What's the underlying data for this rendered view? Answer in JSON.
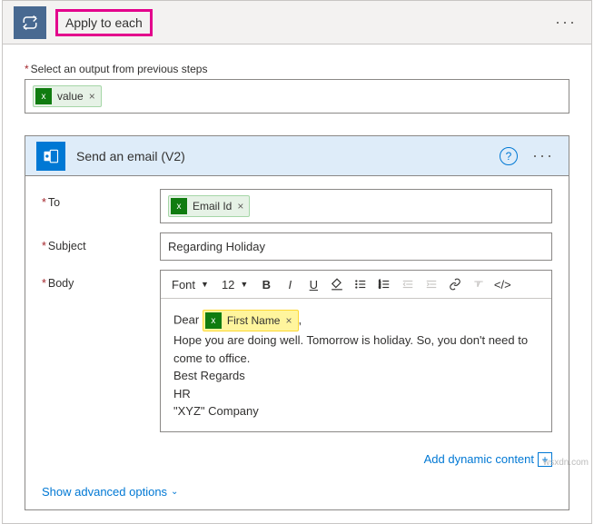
{
  "outer": {
    "title": "Apply to each",
    "output_label": "Select an output from previous steps",
    "value_token": "value"
  },
  "email": {
    "title": "Send an email (V2)",
    "to_label": "To",
    "to_token": "Email Id",
    "subject_label": "Subject",
    "subject_value": "Regarding Holiday",
    "body_label": "Body",
    "font_label": "Font",
    "size_label": "12",
    "greeting": "Dear",
    "first_name_token": "First Name",
    "greeting_after": ",",
    "line1": "Hope you are doing well. Tomorrow is holiday. So, you don't need to come to office.",
    "line2": "Best Regards",
    "line3": "HR",
    "line4": "\"XYZ\" Company",
    "advanced": "Show advanced options",
    "dynamic": "Add dynamic content"
  },
  "watermark": "wsxdn.com"
}
